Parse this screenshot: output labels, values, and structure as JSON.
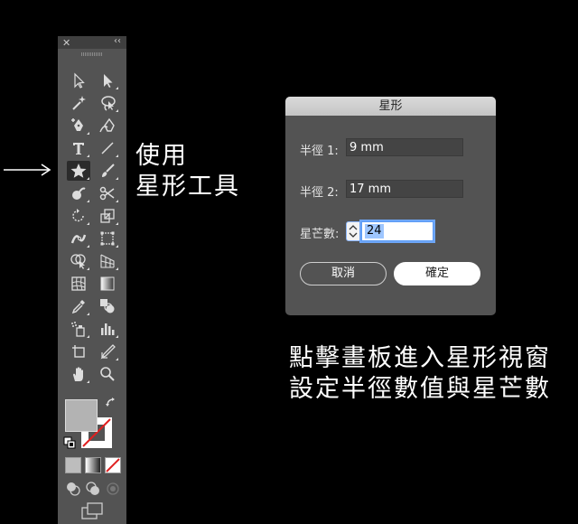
{
  "tool_panel": {
    "close_glyph": "✕",
    "collapse_glyph": "‹‹",
    "tools": [
      [
        "selection-tool",
        "direct-selection-tool"
      ],
      [
        "magic-wand-tool",
        "lasso-tool"
      ],
      [
        "pen-tool",
        "curvature-tool"
      ],
      [
        "type-tool",
        "line-segment-tool"
      ],
      [
        "star-tool",
        "paintbrush-tool"
      ],
      [
        "shaper-tool",
        "scissors-tool"
      ],
      [
        "rotate-tool",
        "scale-tool"
      ],
      [
        "width-tool",
        "free-transform-tool"
      ],
      [
        "shape-builder-tool",
        "perspective-grid-tool"
      ],
      [
        "mesh-tool",
        "gradient-tool"
      ],
      [
        "eyedropper-tool",
        "blend-tool"
      ],
      [
        "symbol-sprayer-tool",
        "column-graph-tool"
      ],
      [
        "artboard-tool",
        "slice-tool"
      ],
      [
        "hand-tool",
        "zoom-tool"
      ]
    ],
    "active_tool": "star-tool"
  },
  "annotations": {
    "left": [
      "使用",
      "星形工具"
    ],
    "right": [
      "點擊畫板進入星形視窗",
      "設定半徑數值與星芒數"
    ]
  },
  "dialog": {
    "title": "星形",
    "radius1_label": "半徑 1:",
    "radius1_value": "9 mm",
    "radius2_label": "半徑 2:",
    "radius2_value": "17 mm",
    "points_label": "星芒數:",
    "points_value": "24",
    "cancel_label": "取消",
    "ok_label": "確定"
  },
  "colors": {
    "background": "#000000",
    "panel": "#535353",
    "fill_swatch": "#b3b3b3",
    "accent_focus": "#5b9cf6"
  }
}
